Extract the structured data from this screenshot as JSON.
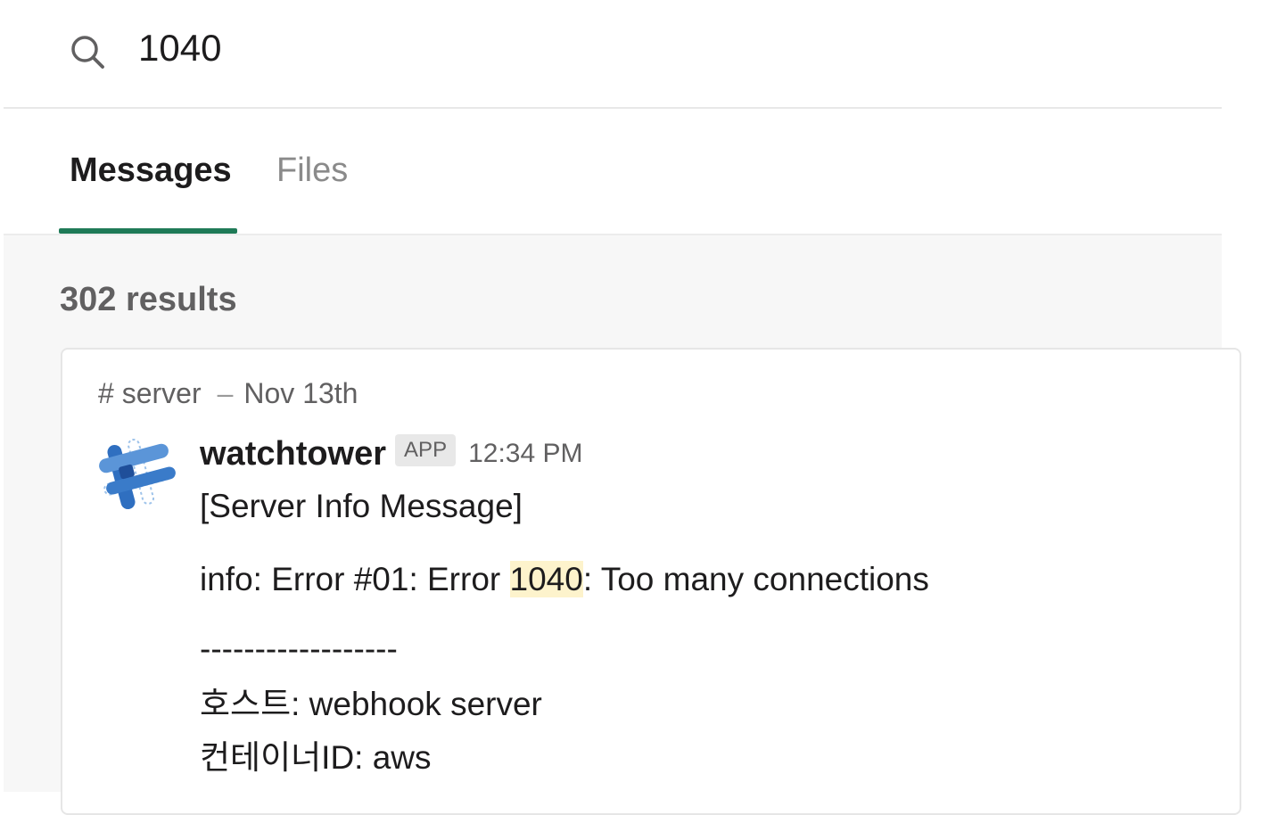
{
  "search": {
    "query": "1040",
    "icon": "search-icon"
  },
  "tabs": [
    {
      "label": "Messages",
      "active": true
    },
    {
      "label": "Files",
      "active": false
    }
  ],
  "accent_color": "#1f7a57",
  "results": {
    "count_label": "302 results"
  },
  "result": {
    "channel": "# server",
    "separator": "–",
    "date": "Nov 13th",
    "sender": "watchtower",
    "badge": "APP",
    "time": "12:34 PM",
    "lines": {
      "title": "[Server Info Message]",
      "info_prefix": "info: Error #01: Error ",
      "info_highlight": "1040",
      "info_suffix": ": Too many connections",
      "divider": "------------------",
      "host": "호스트: webhook server",
      "container": "컨테이너ID: aws"
    }
  }
}
